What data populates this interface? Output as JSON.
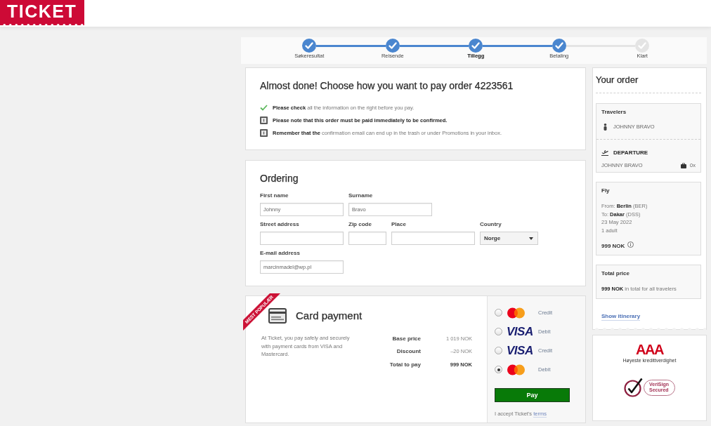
{
  "header": {
    "logo": "TICKET"
  },
  "steps": [
    {
      "label": "Søkeresultat",
      "done": true,
      "current": false
    },
    {
      "label": "Reisende",
      "done": true,
      "current": false
    },
    {
      "label": "Tillegg",
      "done": true,
      "current": true
    },
    {
      "label": "Betaling",
      "done": true,
      "current": false
    },
    {
      "label": "Klart",
      "done": false,
      "current": false
    }
  ],
  "summary": {
    "title": "Almost done! Choose how you want to pay order 4223561",
    "notes": [
      {
        "kind": "check",
        "text": "**Please check** all the information on the right before you pay.",
        "emphasis": false
      },
      {
        "kind": "notice",
        "text": "Please note that this order must be paid immediately to be confirmed.",
        "emphasis": true
      },
      {
        "kind": "notice",
        "text": "**Remember that the** confirmation email can end up in the trash or under Promotions in your inbox.",
        "emphasis": false
      }
    ]
  },
  "ordering": {
    "title": "Ordering",
    "rows": [
      [
        {
          "label": "First name",
          "kind": "text",
          "value": "Johnny"
        },
        {
          "label": "Surname",
          "kind": "text",
          "value": "Bravo"
        }
      ],
      [
        {
          "label": "Street address",
          "kind": "text"
        },
        {
          "label": "Zip code",
          "kind": "short"
        },
        {
          "label": "Place",
          "kind": "text"
        },
        {
          "label": "Country",
          "kind": "select",
          "value": "Norge"
        }
      ],
      [
        {
          "label": "E-mail address",
          "kind": "text",
          "value": "marcinmadel@wp.pl"
        }
      ]
    ]
  },
  "payment": {
    "ribbon": "MEST POPULÆR",
    "title": "Card payment",
    "description": "At Ticket, you pay safely and securely with payment cards from VISA and Mastercard.",
    "prices": [
      {
        "label": "Base price",
        "value": "1 019 NOK",
        "total": false
      },
      {
        "label": "Discount",
        "value": "–20 NOK",
        "total": false
      },
      {
        "label": "Total to pay",
        "value": "999 NOK",
        "total": true
      }
    ],
    "methods": [
      {
        "kind": "mastercard",
        "type": "Credit",
        "selected": false
      },
      {
        "kind": "visa",
        "logo": "VISA",
        "type": "Debit",
        "selected": false
      },
      {
        "kind": "visa",
        "logo": "VISA",
        "type": "Credit",
        "selected": false
      },
      {
        "kind": "mastercard",
        "type": "Debit",
        "selected": true
      }
    ],
    "pay_button": "Pay",
    "terms": "I accept Ticket's",
    "terms_link": "terms"
  },
  "order": {
    "title": "Your order",
    "travelers": {
      "title": "Travelers",
      "people": [
        "JOHNNY BRAVO"
      ]
    },
    "legs": [
      {
        "title": "DEPARTURE",
        "passenger": "JOHNNY BRAVO",
        "bags": "0x"
      }
    ],
    "flight": {
      "title": "Fly",
      "lines": [
        "From: **Berlin** (BER)",
        "To: **Dakar** (DSS)",
        "23 May 2022",
        "1 adult"
      ],
      "price": "999 NOK"
    },
    "total": {
      "title": "Total price",
      "text": "**999 NOK** in total for all travelers"
    },
    "itinerary_link": "Show itinerary"
  },
  "badges": [
    {
      "kind": "rating",
      "title": "AAA",
      "caption": "Høyeste kredittverdighet"
    },
    {
      "kind": "seal",
      "title": "VeriSign",
      "caption": "Secured"
    }
  ]
}
